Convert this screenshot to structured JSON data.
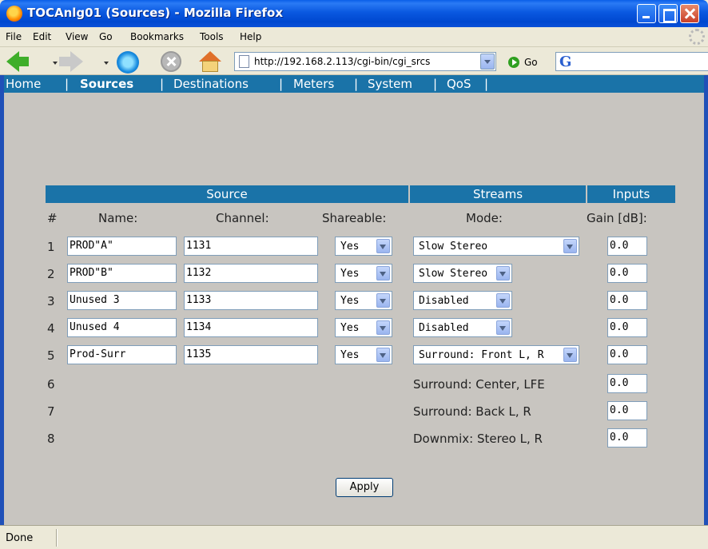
{
  "window": {
    "title": "TOCAnlg01 (Sources) - Mozilla Firefox"
  },
  "menu": [
    "File",
    "Edit",
    "View",
    "Go",
    "Bookmarks",
    "Tools",
    "Help"
  ],
  "toolbar": {
    "url": "http://192.168.2.113/cgi-bin/cgi_srcs",
    "go_label": "Go",
    "search_icon": "G"
  },
  "sitenav": {
    "items": [
      "Home",
      "Sources",
      "Destinations",
      "Meters",
      "System",
      "QoS"
    ],
    "active": "Sources",
    "separator": "|"
  },
  "table": {
    "groups": {
      "source": "Source",
      "streams": "Streams",
      "inputs": "Inputs"
    },
    "columns": {
      "num": "#",
      "name": "Name:",
      "channel": "Channel:",
      "shareable": "Shareable:",
      "mode": "Mode:",
      "gain": "Gain [dB]:"
    },
    "rows": [
      {
        "num": "1",
        "name": "PROD\"A\"",
        "channel": "1131",
        "shareable": "Yes",
        "mode": "Slow Stereo",
        "gain": "0.0"
      },
      {
        "num": "2",
        "name": "PROD\"B\"",
        "channel": "1132",
        "shareable": "Yes",
        "mode": "Slow Stereo",
        "gain": "0.0"
      },
      {
        "num": "3",
        "name": "Unused 3",
        "channel": "1133",
        "shareable": "Yes",
        "mode": "Disabled",
        "gain": "0.0"
      },
      {
        "num": "4",
        "name": "Unused 4",
        "channel": "1134",
        "shareable": "Yes",
        "mode": "Disabled",
        "gain": "0.0"
      },
      {
        "num": "5",
        "name": "Prod-Surr",
        "channel": "1135",
        "shareable": "Yes",
        "mode": "Surround: Front L, R",
        "gain": "0.0"
      },
      {
        "num": "6",
        "mode": "Surround: Center, LFE",
        "gain": "0.0"
      },
      {
        "num": "7",
        "mode": "Surround: Back L, R",
        "gain": "0.0"
      },
      {
        "num": "8",
        "mode": "Downmix: Stereo L, R",
        "gain": "0.0"
      }
    ]
  },
  "apply_label": "Apply",
  "status": "Done",
  "icons": [
    "firefox-logo-icon",
    "back-arrow-icon",
    "forward-arrow-icon",
    "reload-icon",
    "stop-icon",
    "home-icon",
    "page-icon",
    "go-icon",
    "google-icon"
  ]
}
